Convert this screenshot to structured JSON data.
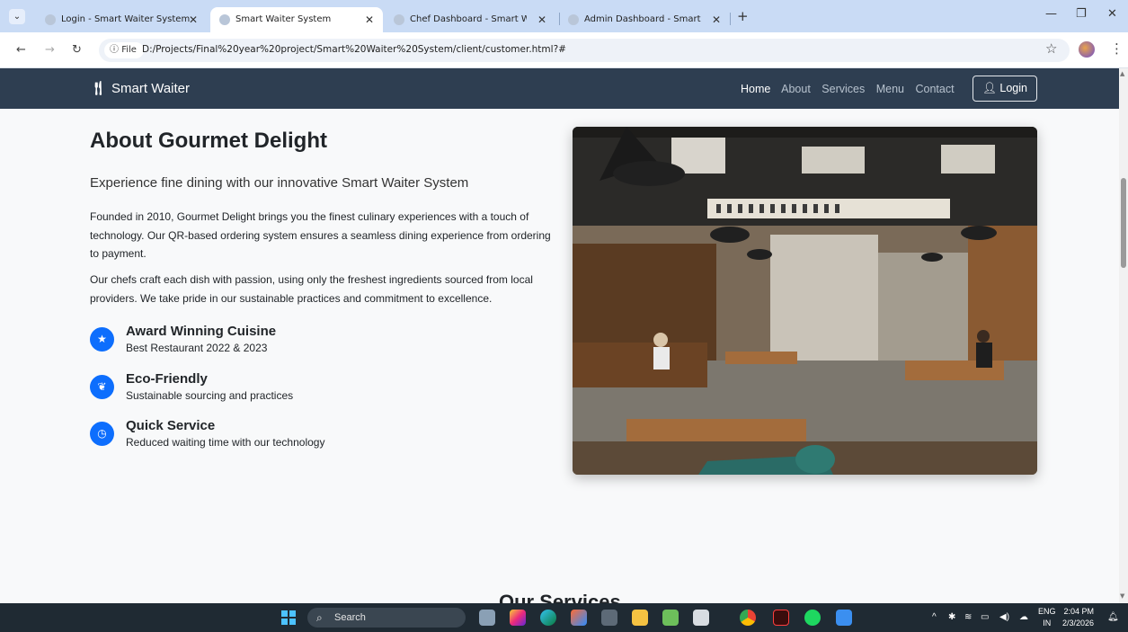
{
  "browser": {
    "tabs": [
      {
        "title": "Login - Smart Waiter System",
        "active": false
      },
      {
        "title": "Smart Waiter System",
        "active": true
      },
      {
        "title": "Chef Dashboard - Smart Waiter",
        "active": false
      },
      {
        "title": "Admin Dashboard - Smart Wait",
        "active": false
      }
    ],
    "new_tab": "+",
    "file_chip": "File",
    "url": "D:/Projects/Final%20year%20project/Smart%20Waiter%20System/client/customer.html?#"
  },
  "site_nav": {
    "brand": "Smart Waiter",
    "brand_icon": "utensils-icon",
    "links": [
      "Home",
      "About",
      "Services",
      "Menu",
      "Contact"
    ],
    "active_link": "Home",
    "login_label": "Login"
  },
  "about": {
    "title": "About Gourmet Delight",
    "lead": "Experience fine dining with our innovative Smart Waiter System",
    "paragraphs": [
      "Founded in 2010, Gourmet Delight brings you the finest culinary experiences with a touch of technology. Our QR-based ordering system ensures a seamless dining experience from ordering to payment.",
      "Our chefs craft each dish with passion, using only the freshest ingredients sourced from local providers. We take pride in our sustainable practices and commitment to excellence."
    ],
    "features": [
      {
        "icon": "award-icon",
        "title": "Award Winning Cuisine",
        "subtitle": "Best Restaurant 2022 & 2023"
      },
      {
        "icon": "leaf-icon",
        "title": "Eco-Friendly",
        "subtitle": "Sustainable sourcing and practices"
      },
      {
        "icon": "clock-icon",
        "title": "Quick Service",
        "subtitle": "Reduced waiting time with our technology"
      }
    ],
    "next_section_heading": "Our Services"
  },
  "taskbar": {
    "search_placeholder": "Search",
    "lang_top": "ENG",
    "lang_bottom": "IN",
    "time": "2:04 PM",
    "date": "2/3/2026"
  },
  "colors": {
    "navbar": "#2e3e51",
    "accent": "#0d6efd",
    "tabstrip": "#c9dbf5"
  }
}
